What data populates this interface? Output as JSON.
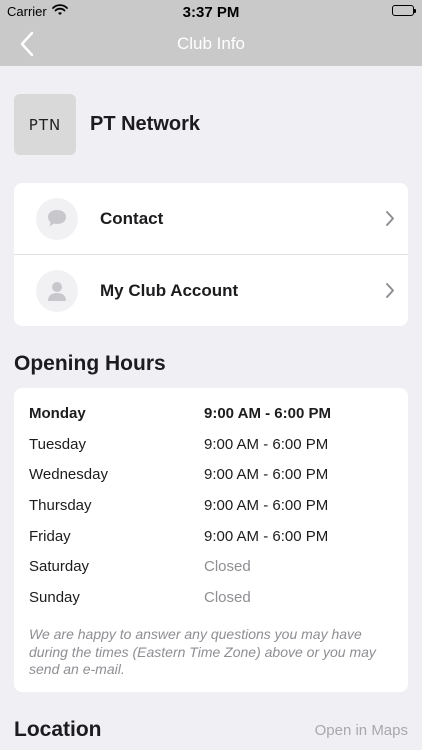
{
  "status_bar": {
    "carrier": "Carrier",
    "time": "3:37 PM"
  },
  "nav": {
    "title": "Club Info"
  },
  "club": {
    "logo_text": "PTN",
    "name": "PT Network"
  },
  "links": [
    {
      "label": "Contact",
      "icon": "chat-bubble-icon"
    },
    {
      "label": "My Club Account",
      "icon": "person-icon"
    }
  ],
  "opening_hours": {
    "title": "Opening Hours",
    "rows": [
      {
        "day": "Monday",
        "time": "9:00 AM - 6:00 PM",
        "today": true
      },
      {
        "day": "Tuesday",
        "time": "9:00 AM - 6:00 PM"
      },
      {
        "day": "Wednesday",
        "time": "9:00 AM - 6:00 PM"
      },
      {
        "day": "Thursday",
        "time": "9:00 AM - 6:00 PM"
      },
      {
        "day": "Friday",
        "time": "9:00 AM - 6:00 PM"
      },
      {
        "day": "Saturday",
        "time": "Closed"
      },
      {
        "day": "Sunday",
        "time": "Closed"
      }
    ],
    "note": "We are happy to answer any questions you may have during the times (Eastern Time Zone) above or you may send an e-mail."
  },
  "location": {
    "title": "Location",
    "open_maps": "Open in Maps"
  },
  "colors": {
    "nav_bar": "#c9c9c9",
    "background": "#efeff4",
    "muted_text": "#8e8e93"
  }
}
